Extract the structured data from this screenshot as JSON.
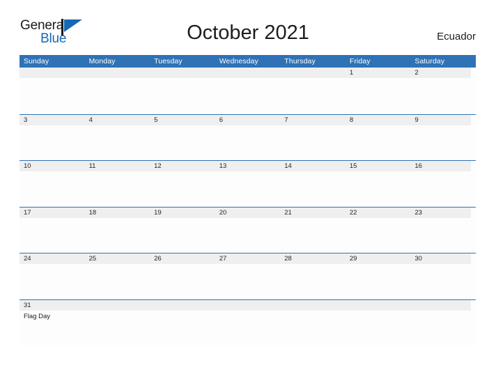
{
  "brand": {
    "name_part1": "General",
    "name_part2": "Blue",
    "mark_icon": "triangle-flag-icon",
    "accent_color": "#1668b3"
  },
  "header": {
    "title": "October 2021",
    "region": "Ecuador"
  },
  "theme": {
    "header_blue": "#2f72b5",
    "row_band_gray": "#efefef",
    "body_white": "#fdfdfd",
    "text_dark": "#1d1d1d"
  },
  "calendar": {
    "month": "October",
    "year": "2021",
    "weekday_headers": [
      "Sunday",
      "Monday",
      "Tuesday",
      "Wednesday",
      "Thursday",
      "Friday",
      "Saturday"
    ],
    "weeks": [
      {
        "days": [
          {
            "number": "",
            "events": []
          },
          {
            "number": "",
            "events": []
          },
          {
            "number": "",
            "events": []
          },
          {
            "number": "",
            "events": []
          },
          {
            "number": "",
            "events": []
          },
          {
            "number": "1",
            "events": []
          },
          {
            "number": "2",
            "events": []
          }
        ]
      },
      {
        "days": [
          {
            "number": "3",
            "events": []
          },
          {
            "number": "4",
            "events": []
          },
          {
            "number": "5",
            "events": []
          },
          {
            "number": "6",
            "events": []
          },
          {
            "number": "7",
            "events": []
          },
          {
            "number": "8",
            "events": []
          },
          {
            "number": "9",
            "events": []
          }
        ]
      },
      {
        "days": [
          {
            "number": "10",
            "events": []
          },
          {
            "number": "11",
            "events": []
          },
          {
            "number": "12",
            "events": []
          },
          {
            "number": "13",
            "events": []
          },
          {
            "number": "14",
            "events": []
          },
          {
            "number": "15",
            "events": []
          },
          {
            "number": "16",
            "events": []
          }
        ]
      },
      {
        "days": [
          {
            "number": "17",
            "events": []
          },
          {
            "number": "18",
            "events": []
          },
          {
            "number": "19",
            "events": []
          },
          {
            "number": "20",
            "events": []
          },
          {
            "number": "21",
            "events": []
          },
          {
            "number": "22",
            "events": []
          },
          {
            "number": "23",
            "events": []
          }
        ]
      },
      {
        "days": [
          {
            "number": "24",
            "events": []
          },
          {
            "number": "25",
            "events": []
          },
          {
            "number": "26",
            "events": []
          },
          {
            "number": "27",
            "events": []
          },
          {
            "number": "28",
            "events": []
          },
          {
            "number": "29",
            "events": []
          },
          {
            "number": "30",
            "events": []
          }
        ]
      },
      {
        "days": [
          {
            "number": "31",
            "events": [
              "Flag Day"
            ]
          },
          {
            "number": "",
            "events": []
          },
          {
            "number": "",
            "events": []
          },
          {
            "number": "",
            "events": []
          },
          {
            "number": "",
            "events": []
          },
          {
            "number": "",
            "events": []
          },
          {
            "number": "",
            "events": []
          }
        ]
      }
    ]
  }
}
